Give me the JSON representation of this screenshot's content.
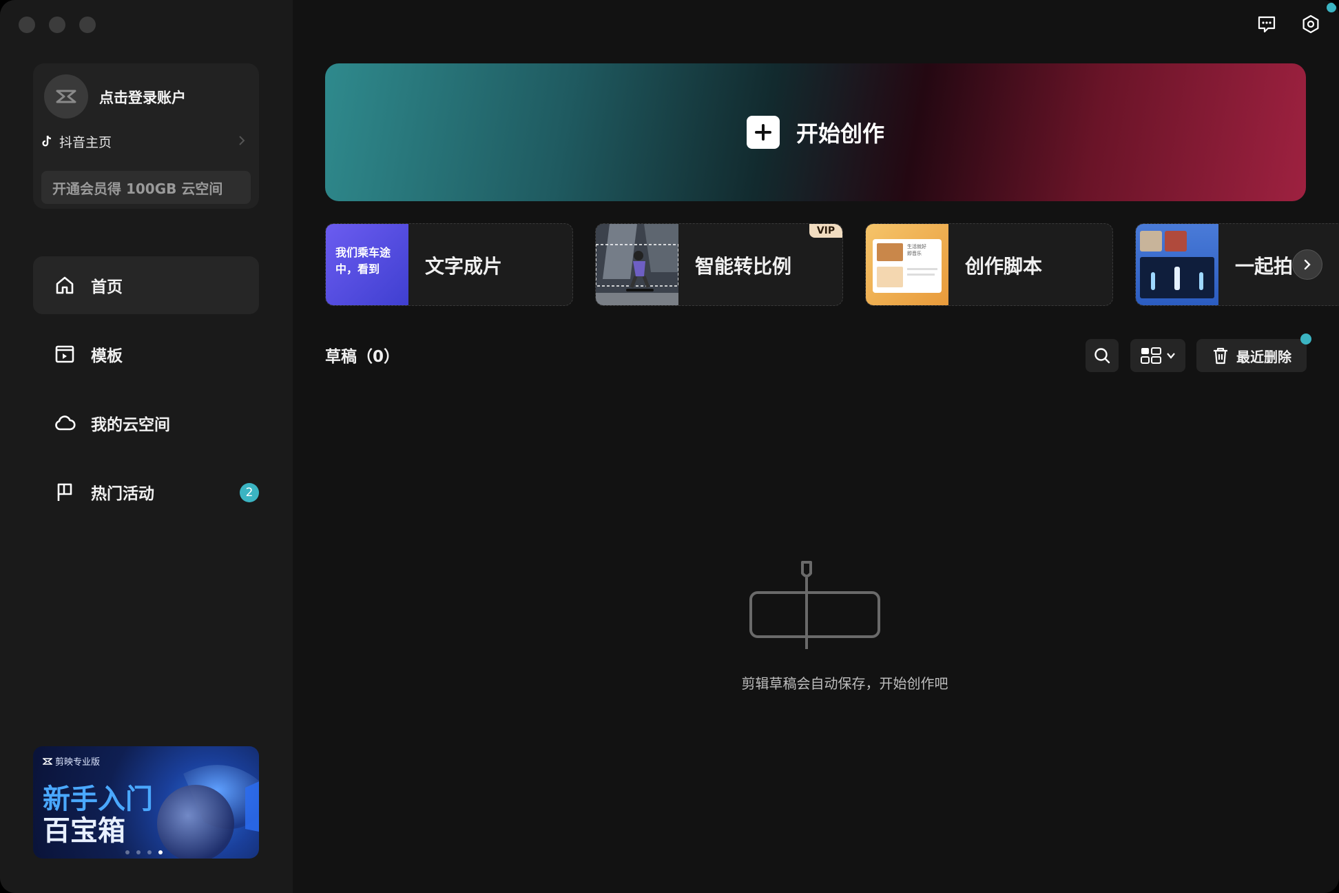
{
  "sidebar": {
    "account": {
      "login_text": "点击登录账户",
      "douyin_label": "抖音主页",
      "vip_promo": "开通会员得 100GB 云空间"
    },
    "nav": [
      {
        "label": "首页",
        "icon": "home-icon",
        "active": true
      },
      {
        "label": "模板",
        "icon": "template-icon",
        "active": false
      },
      {
        "label": "我的云空间",
        "icon": "cloud-icon",
        "active": false
      },
      {
        "label": "热门活动",
        "icon": "flag-icon",
        "active": false,
        "badge": "2"
      }
    ],
    "banner": {
      "brand": "剪映专业版",
      "line1": "新手入门",
      "line2": "百宝箱"
    }
  },
  "hero": {
    "title": "开始创作"
  },
  "features": [
    {
      "label": "文字成片",
      "thumb_text": "我们乘车途中，看到"
    },
    {
      "label": "智能转比例",
      "tag": "VIP"
    },
    {
      "label": "创作脚本",
      "thumb_text_1": "生活就好",
      "thumb_text_2": "即音乐"
    },
    {
      "label": "一起拍"
    }
  ],
  "drafts": {
    "title": "草稿（0）",
    "recent_delete": "最近删除"
  },
  "empty": {
    "message": "剪辑草稿会自动保存，开始创作吧"
  },
  "colors": {
    "accent": "#3bb4c2",
    "bg": "#121212",
    "sidebar": "#1a1a1a"
  }
}
